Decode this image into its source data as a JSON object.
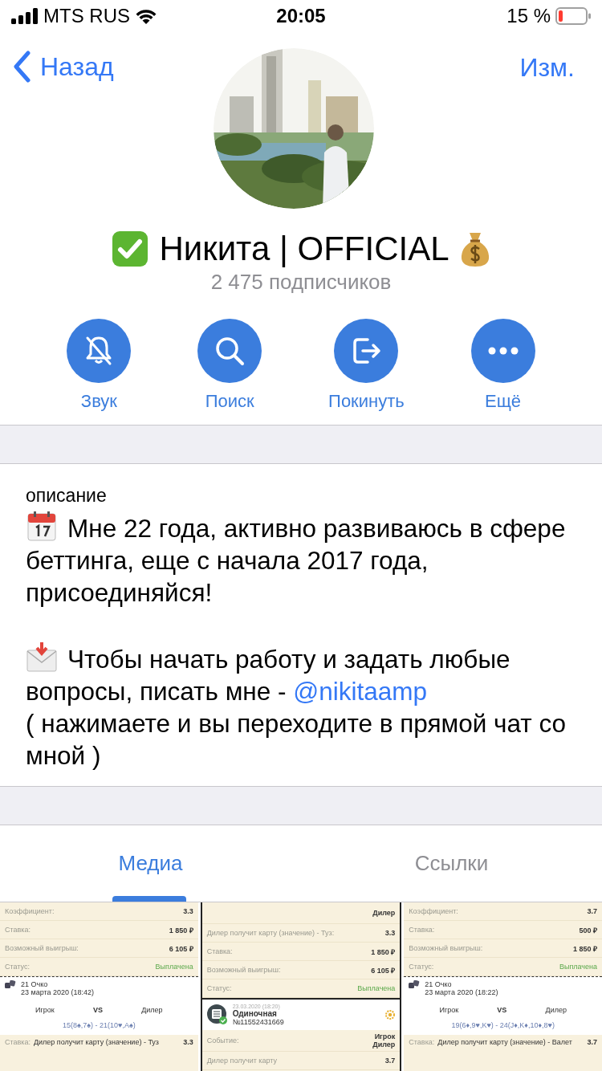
{
  "status_bar": {
    "carrier": "MTS RUS",
    "time": "20:05",
    "battery": "15 %"
  },
  "nav": {
    "back": "Назад",
    "edit": "Изм."
  },
  "profile": {
    "name": "Никита | OFFICIAL",
    "subscribers": "2 475 подписчиков"
  },
  "actions": [
    {
      "kind": "mute",
      "label": "Звук"
    },
    {
      "kind": "search",
      "label": "Поиск"
    },
    {
      "kind": "leave",
      "label": "Покинуть"
    },
    {
      "kind": "more",
      "label": "Ещё"
    }
  ],
  "description": {
    "label": "описание",
    "paragraphs": [
      {
        "text": "Мне 22 года, активно развиваюсь в сфере беттинга, еще с начала 2017 года, присоединяйся!"
      },
      {
        "text": "Чтобы начать работу и задать любые вопросы, писать мне - ",
        "link": "@nikitaamp",
        "note": "( нажимаете и вы переходите в прямой чат со мной )"
      }
    ]
  },
  "tabs": [
    {
      "label": "Медиа",
      "selected": true
    },
    {
      "label": "Ссылки",
      "selected": false
    }
  ],
  "media": [
    {
      "blocks": [
        {
          "kind": "row",
          "label": "Коэффициент:",
          "value": "3.3"
        },
        {
          "kind": "row",
          "label": "Ставка:",
          "value": "1 850 ₽"
        },
        {
          "kind": "row",
          "label": "Возможный выигрыш:",
          "value": "6 105 ₽"
        },
        {
          "kind": "status",
          "label": "Статус:",
          "value": "Выплачена"
        },
        {
          "kind": "game",
          "title": "21 Очко",
          "date": "23 марта 2020 (18:42)"
        },
        {
          "kind": "versus",
          "left": "Игрок",
          "mid": "VS",
          "right": "Дилер"
        },
        {
          "kind": "score",
          "text": "15(8♠,7♠) - 21(10♥,A♠)"
        },
        {
          "kind": "bet",
          "label": "Ставка:",
          "text": "Дилер получит карту (значение) - Туз",
          "value": "3.3"
        }
      ]
    },
    {
      "blocks": [
        {
          "kind": "event",
          "values": [
            "Дилер"
          ]
        },
        {
          "kind": "row",
          "label": "Дилер получит карту (значение) - Туз:",
          "value": "3.3"
        },
        {
          "kind": "row",
          "label": "Ставка:",
          "value": "1 850 ₽"
        },
        {
          "kind": "row",
          "label": "Возможный выигрыш:",
          "value": "6 105 ₽"
        },
        {
          "kind": "status",
          "label": "Статус:",
          "value": "Выплачена"
        },
        {
          "kind": "header",
          "date": "23.03.2020 (18:20)",
          "title": "Одиночная",
          "number": "№11552431669"
        },
        {
          "kind": "event",
          "label": "Событие:",
          "values": [
            "Игрок",
            "Дилер"
          ]
        },
        {
          "kind": "row",
          "label": "Дилер получит карту",
          "value": "3.7"
        }
      ]
    },
    {
      "blocks": [
        {
          "kind": "row",
          "label": "Коэффициент:",
          "value": "3.7"
        },
        {
          "kind": "row",
          "label": "Ставка:",
          "value": "500 ₽"
        },
        {
          "kind": "row",
          "label": "Возможный выигрыш:",
          "value": "1 850 ₽"
        },
        {
          "kind": "status",
          "label": "Статус:",
          "value": "Выплачена"
        },
        {
          "kind": "game",
          "title": "21 Очко",
          "date": "23 марта 2020 (18:22)"
        },
        {
          "kind": "versus",
          "left": "Игрок",
          "mid": "VS",
          "right": "Дилер"
        },
        {
          "kind": "score",
          "text": "19(6♦,9♥,K♥) - 24(J♦,K♦,10♦,8♥)"
        },
        {
          "kind": "bet",
          "label": "Ставка:",
          "text": "Дилер получит карту (значение) - Валет",
          "value": "3.7"
        }
      ]
    }
  ]
}
